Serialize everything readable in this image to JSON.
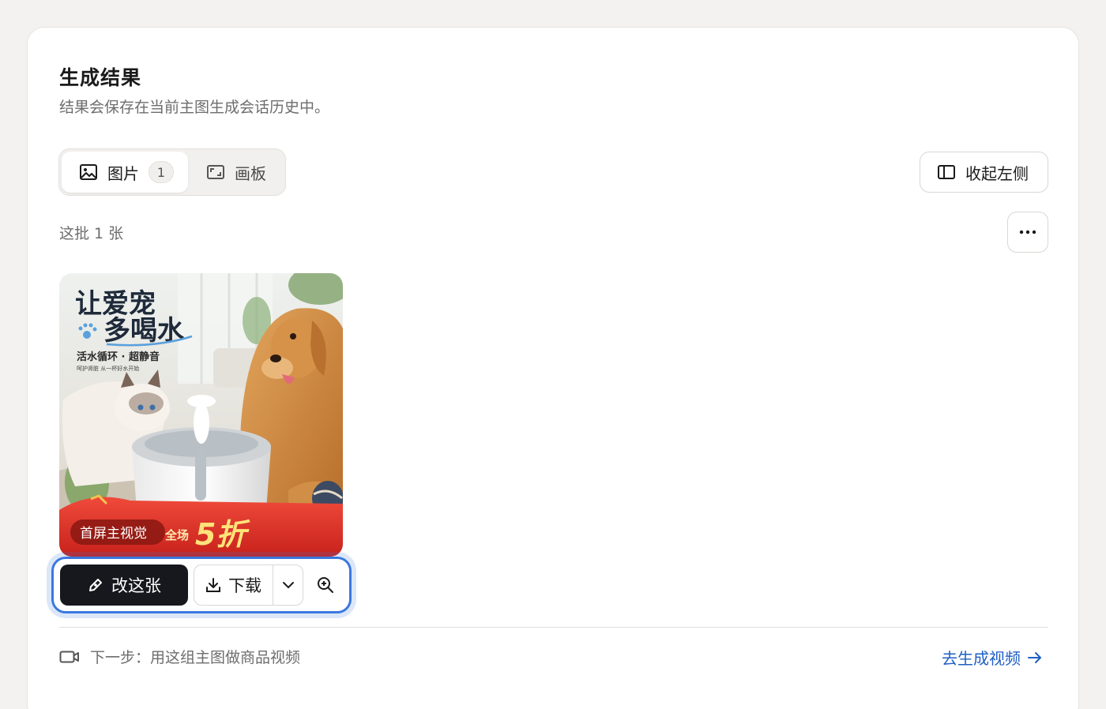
{
  "panel": {
    "title": "生成结果",
    "subtitle": "结果会保存在当前主图生成会话历史中。"
  },
  "tabs": [
    {
      "label": "图片",
      "count": "1",
      "icon": "image-icon",
      "active": true
    },
    {
      "label": "画板",
      "icon": "artboard-icon",
      "active": false
    }
  ],
  "toolbar": {
    "collapse_label": "收起左侧",
    "collapse_icon": "sidebar-panel-icon",
    "more_icon": "ellipsis-icon"
  },
  "batch": {
    "label": "这批 1 张"
  },
  "image": {
    "headline_line1": "让爱宠",
    "headline_line2": "多喝水",
    "feature_text": "活水循环 · 超静音",
    "small_text": "呵护肾脏  从一杯好水开始",
    "badge_text": "首屏主视觉",
    "promo_prefix": "全场",
    "promo_discount": "5折"
  },
  "actions": {
    "edit_label": "改这张",
    "edit_icon": "pen-icon",
    "download_label": "下载",
    "download_icon": "download-icon",
    "dropdown_icon": "chevron-down-icon",
    "zoom_icon": "zoom-in-icon"
  },
  "footer": {
    "next_step_text": "下一步：用这组主图做商品视频",
    "next_step_icon": "video-camera-icon",
    "go_video_label": "去生成视频",
    "go_video_icon": "arrow-right-icon"
  },
  "colors": {
    "accent": "#3a78e0",
    "link": "#1f5fc4",
    "primary_button": "#16181d",
    "promo_red": "#e0312b"
  }
}
